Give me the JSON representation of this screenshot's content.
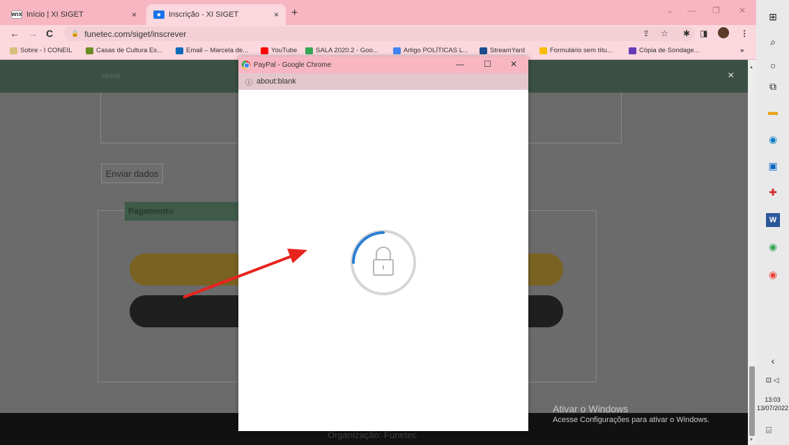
{
  "browser": {
    "tabs": [
      {
        "favicon": "WIX",
        "title": "Início | XI SIGET",
        "close": "×"
      },
      {
        "favicon": "◆",
        "title": "Inscrição - XI SIGET",
        "close": "×"
      }
    ],
    "new_tab": "+",
    "window_controls": {
      "dropdown": "⌄",
      "minimize": "—",
      "restore": "❐",
      "close": "✕"
    },
    "nav": {
      "back": "←",
      "forward": "→",
      "reload": "C"
    },
    "url": "funetec.com/siget/inscrever",
    "omnibox_icons": [
      "⇪",
      "☆",
      "✱",
      "◨",
      "⋮"
    ],
    "bookmarks": [
      {
        "label": "Sobre - I CONEIL",
        "color": "#d9c07a"
      },
      {
        "label": "Casas de Cultura Es...",
        "color": "#6b8e23"
      },
      {
        "label": "Email – Marcela de...",
        "color": "#0f6cbd"
      },
      {
        "label": "YouTube",
        "color": "#ff0000"
      },
      {
        "label": "SALA 2020.2 - Goo...",
        "color": "#34a853"
      },
      {
        "label": "Artigo POLÍTICAS L...",
        "color": "#4285f4"
      },
      {
        "label": "StreamYard",
        "color": "#1a4d8f"
      },
      {
        "label": "Formulário sem títu...",
        "color": "#fbbc05"
      },
      {
        "label": "Cópia de Sondage...",
        "color": "#673ab7"
      }
    ],
    "more_bookmarks": "»"
  },
  "page": {
    "home_link": "Home",
    "modal_close": "×",
    "send_button": "Enviar dados",
    "payment_title": "Pagamento",
    "footer_text": "Organização: Funetec",
    "watermark_title": "Ativar o Windows",
    "watermark_subtitle": "Acesse Configurações para ativar o Windows."
  },
  "popup": {
    "title": "PayPal - Google Chrome",
    "controls": {
      "minimize": "—",
      "maximize": "☐",
      "close": "✕"
    },
    "url": "about:blank",
    "spinner_color": "#2a7fd4"
  },
  "annotation": {
    "arrow_color": "#e8231e"
  },
  "taskbar": {
    "start": "⊞",
    "icons": [
      "⌕",
      "○",
      "⧉",
      "▬",
      "◉",
      "▣",
      "✚",
      "W",
      "◉",
      "◉"
    ],
    "chevron": "‹",
    "tray": "⊡ ◁",
    "time": "13:03",
    "date": "13/07/2022",
    "notifications": "⌸"
  }
}
